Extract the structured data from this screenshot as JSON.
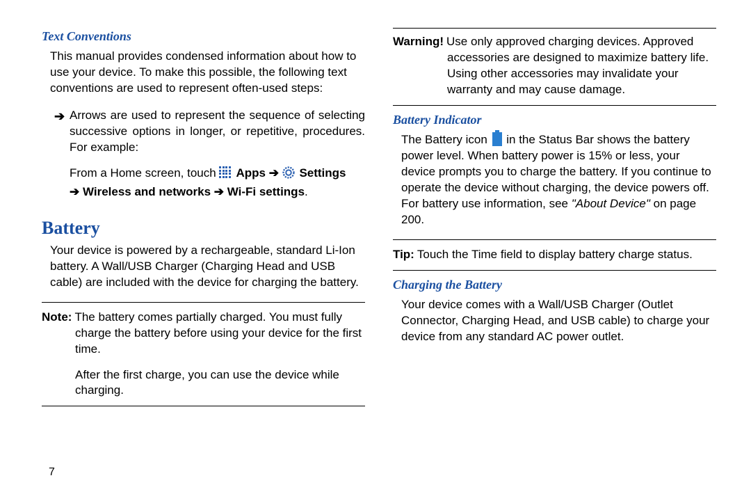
{
  "left": {
    "textConventions": {
      "heading": "Text Conventions",
      "intro": "This manual provides condensed information about how to use your device. To make this possible, the following text conventions are used to represent often-used steps:",
      "arrowBullet": "➔",
      "arrowDesc": "Arrows are used to represent the sequence of selecting successive options in longer, or repetitive, procedures. For example:",
      "exampleLead": "From a Home screen, touch ",
      "appsLabel": " Apps ",
      "arrow1": "➔ ",
      "settingsLabel": " Settings",
      "navLine": "➔ Wireless and networks ➔ Wi-Fi settings",
      "navPeriod": "."
    },
    "battery": {
      "heading": "Battery",
      "intro": "Your device is powered by a rechargeable, standard Li-Ion battery. A Wall/USB Charger (Charging Head and USB cable) are included with the device for charging the battery.",
      "noteLabel": "Note:",
      "noteBody": "The battery comes partially charged. You must fully charge the battery before using your device for the first time.",
      "afterNote": "After the first charge, you can use the device while charging."
    },
    "pageNumber": "7"
  },
  "right": {
    "warning": {
      "label": "Warning!",
      "body": "Use only approved charging devices. Approved accessories are designed to maximize battery life. Using other accessories may invalidate your warranty and may cause damage."
    },
    "batteryIndicator": {
      "heading": "Battery Indicator",
      "part1": "The Battery icon ",
      "part2": " in the Status Bar shows the battery power level. When battery power is 15% or less, your device prompts you to charge the battery. If you continue to operate the device without charging, the device powers off. For battery use information, see ",
      "ref": "\"About Device\"",
      "part3": " on page 200."
    },
    "tip": {
      "label": "Tip:",
      "body": "Touch the Time field to display battery charge status."
    },
    "charging": {
      "heading": "Charging the Battery",
      "body": "Your device comes with a Wall/USB Charger (Outlet Connector, Charging Head, and USB cable) to charge your device from any standard AC power outlet."
    }
  }
}
